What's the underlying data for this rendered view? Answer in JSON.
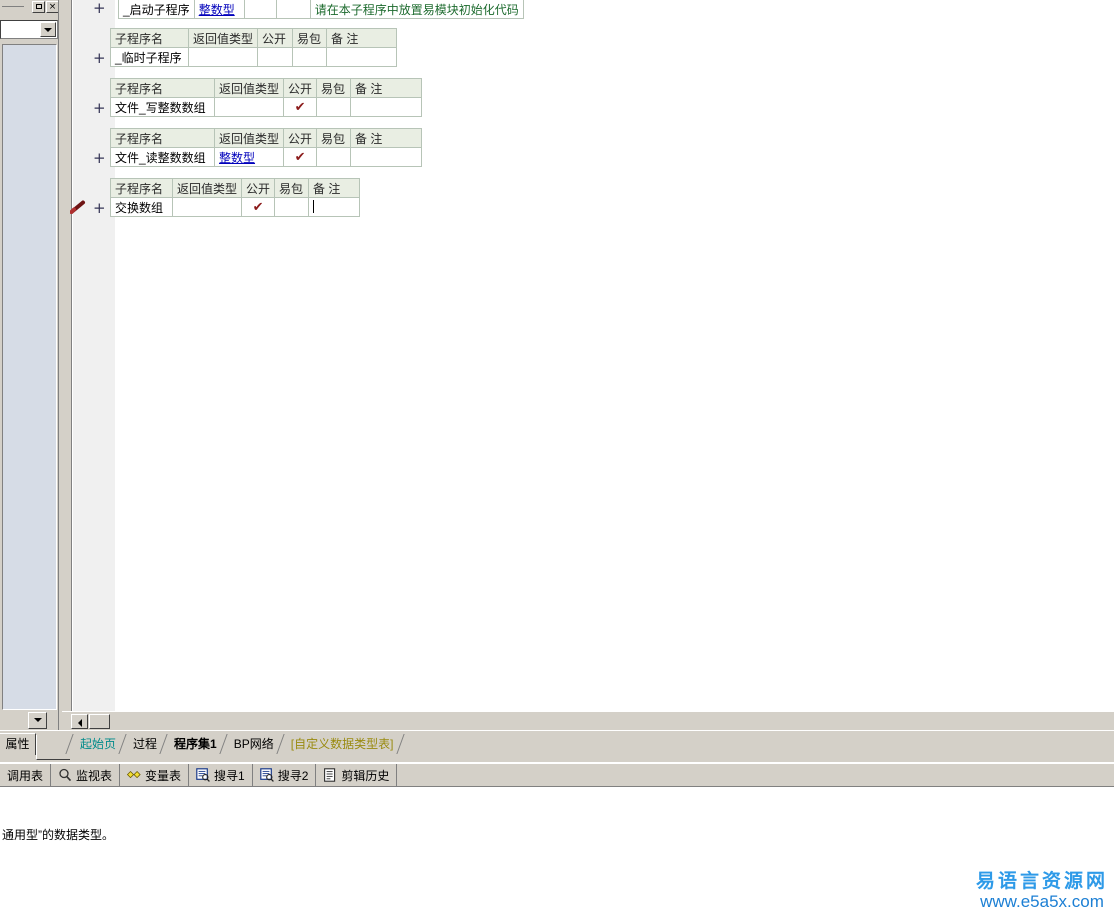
{
  "left_panel": {
    "restore_button_label": "",
    "close_button_label": "×",
    "combo_value": "",
    "scroll_down_label": ""
  },
  "editor": {
    "expander_label": "+",
    "tables": [
      {
        "id": "table-start-sub",
        "show_header": false,
        "columns": [
          "子程序名",
          "返回值类型",
          "公开",
          "易包",
          "备 注"
        ],
        "row": {
          "name": "_启动子程序",
          "return_type": "整数型",
          "public": "",
          "easy_pack": "",
          "note": "请在本子程序中放置易模块初始化代码"
        }
      },
      {
        "id": "table-temp-sub",
        "show_header": true,
        "columns": [
          "子程序名",
          "返回值类型",
          "公开",
          "易包",
          "备 注"
        ],
        "row": {
          "name": "_临时子程序",
          "return_type": "",
          "public": "",
          "easy_pack": "",
          "note": ""
        }
      },
      {
        "id": "table-file-write-intarray",
        "show_header": true,
        "columns": [
          "子程序名",
          "返回值类型",
          "公开",
          "易包",
          "备 注"
        ],
        "row": {
          "name": "文件_写整数数组",
          "return_type": "",
          "public": "✔",
          "easy_pack": "",
          "note": ""
        }
      },
      {
        "id": "table-file-read-intarray",
        "show_header": true,
        "columns": [
          "子程序名",
          "返回值类型",
          "公开",
          "易包",
          "备 注"
        ],
        "row": {
          "name": "文件_读整数数组",
          "return_type": "整数型",
          "public": "✔",
          "easy_pack": "",
          "note": ""
        }
      },
      {
        "id": "table-swap-array",
        "show_header": true,
        "columns": [
          "子程序名",
          "返回值类型",
          "公开",
          "易包",
          "备 注"
        ],
        "row": {
          "name": "交换数组",
          "return_type": "",
          "public": "✔",
          "easy_pack": "",
          "note": ""
        }
      }
    ]
  },
  "hscroll": {
    "left_arrow": "",
    "thumb": ""
  },
  "tabstrip": {
    "property_tab_label": "属性",
    "doc_tabs": [
      {
        "label": "起始页",
        "state": "start"
      },
      {
        "label": "过程",
        "state": "normal"
      },
      {
        "label": "程序集1",
        "state": "active"
      },
      {
        "label": "BP网络",
        "state": "normal"
      },
      {
        "label": "[自定义数据类型表]",
        "state": "custom"
      }
    ]
  },
  "bottom_toolbar": {
    "items": [
      {
        "label": "调用表",
        "icon": "none"
      },
      {
        "label": "监视表",
        "icon": "magnifier-icon"
      },
      {
        "label": "变量表",
        "icon": "diamonds-icon"
      },
      {
        "label": "搜寻1",
        "icon": "find-box-icon"
      },
      {
        "label": "搜寻2",
        "icon": "find-box-icon"
      },
      {
        "label": "剪辑历史",
        "icon": "document-icon"
      }
    ]
  },
  "status": {
    "description": "通用型”的数据类型。"
  },
  "watermark": {
    "site_name": "易语言资源网",
    "url": "www.e5a5x.com"
  },
  "colors": {
    "chrome": "#d4d0c8",
    "table_header": "#e9eee3",
    "table_border": "#b7c4b7",
    "type_link": "#0000bb",
    "note_green": "#1d6b2e",
    "check_red": "#8b1a1a",
    "tab_start": "#008b8b",
    "tab_custom": "#9a8b10",
    "watermark_blue": "#2e9ae8"
  }
}
